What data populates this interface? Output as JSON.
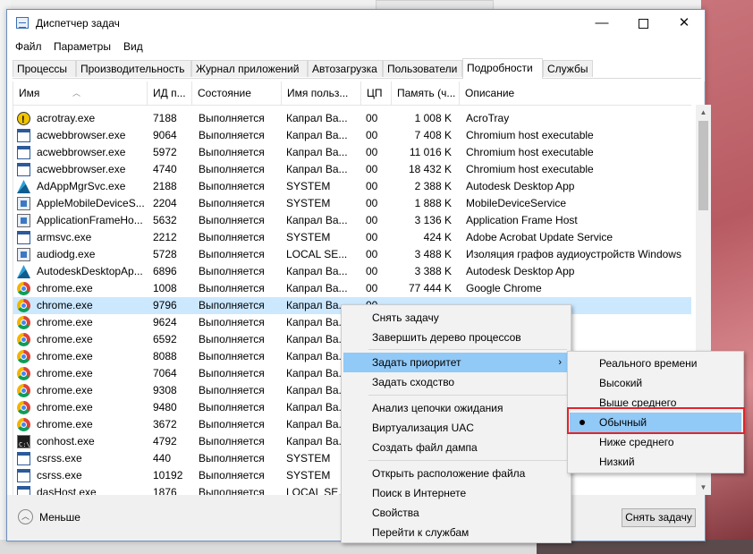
{
  "window": {
    "title": "Диспетчер задач",
    "minimize": "—",
    "close": "✕"
  },
  "menu": [
    "Файл",
    "Параметры",
    "Вид"
  ],
  "tabs": [
    "Процессы",
    "Производительность",
    "Журнал приложений",
    "Автозагрузка",
    "Пользователи",
    "Подробности",
    "Службы"
  ],
  "active_tab": "Подробности",
  "columns": [
    "Имя",
    "ИД п...",
    "Состояние",
    "Имя польз...",
    "ЦП",
    "Память (ч...",
    "Описание"
  ],
  "rows": [
    {
      "icon": "warning-icon",
      "name": "acrotray.exe",
      "pid": "7188",
      "state": "Выполняется",
      "user": "Капрал Ва...",
      "cpu": "00",
      "mem": "1 008 K",
      "desc": "AcroTray"
    },
    {
      "icon": "window-icon",
      "name": "acwebbrowser.exe",
      "pid": "9064",
      "state": "Выполняется",
      "user": "Капрал Ва...",
      "cpu": "00",
      "mem": "7 408 K",
      "desc": "Chromium host executable"
    },
    {
      "icon": "window-icon",
      "name": "acwebbrowser.exe",
      "pid": "5972",
      "state": "Выполняется",
      "user": "Капрал Ва...",
      "cpu": "00",
      "mem": "11 016 K",
      "desc": "Chromium host executable"
    },
    {
      "icon": "window-icon",
      "name": "acwebbrowser.exe",
      "pid": "4740",
      "state": "Выполняется",
      "user": "Капрал Ва...",
      "cpu": "00",
      "mem": "18 432 K",
      "desc": "Chromium host executable"
    },
    {
      "icon": "autodesk-icon",
      "name": "AdAppMgrSvc.exe",
      "pid": "2188",
      "state": "Выполняется",
      "user": "SYSTEM",
      "cpu": "00",
      "mem": "2 388 K",
      "desc": "Autodesk Desktop App"
    },
    {
      "icon": "service-icon",
      "name": "AppleMobileDeviceS...",
      "pid": "2204",
      "state": "Выполняется",
      "user": "SYSTEM",
      "cpu": "00",
      "mem": "1 888 K",
      "desc": "MobileDeviceService"
    },
    {
      "icon": "service-icon",
      "name": "ApplicationFrameHo...",
      "pid": "5632",
      "state": "Выполняется",
      "user": "Капрал Ва...",
      "cpu": "00",
      "mem": "3 136 K",
      "desc": "Application Frame Host"
    },
    {
      "icon": "window-icon",
      "name": "armsvc.exe",
      "pid": "2212",
      "state": "Выполняется",
      "user": "SYSTEM",
      "cpu": "00",
      "mem": "424 K",
      "desc": "Adobe Acrobat Update Service"
    },
    {
      "icon": "service-icon",
      "name": "audiodg.exe",
      "pid": "5728",
      "state": "Выполняется",
      "user": "LOCAL SE...",
      "cpu": "00",
      "mem": "3 488 K",
      "desc": "Изоляция графов аудиоустройств Windows"
    },
    {
      "icon": "autodesk-icon",
      "name": "AutodeskDesktopAp...",
      "pid": "6896",
      "state": "Выполняется",
      "user": "Капрал Ва...",
      "cpu": "00",
      "mem": "3 388 K",
      "desc": "Autodesk Desktop App"
    },
    {
      "icon": "chrome-icon",
      "name": "chrome.exe",
      "pid": "1008",
      "state": "Выполняется",
      "user": "Капрал Ва...",
      "cpu": "00",
      "mem": "77 444 K",
      "desc": "Google Chrome"
    },
    {
      "icon": "chrome-icon",
      "name": "chrome.exe",
      "pid": "9796",
      "state": "Выполняется",
      "user": "Капрал Ва...",
      "cpu": "00",
      "mem": "",
      "desc": ""
    },
    {
      "icon": "chrome-icon",
      "name": "chrome.exe",
      "pid": "9624",
      "state": "Выполняется",
      "user": "Капрал Ва...",
      "cpu": "",
      "mem": "",
      "desc": ""
    },
    {
      "icon": "chrome-icon",
      "name": "chrome.exe",
      "pid": "6592",
      "state": "Выполняется",
      "user": "Капрал Ва...",
      "cpu": "",
      "mem": "",
      "desc": ""
    },
    {
      "icon": "chrome-icon",
      "name": "chrome.exe",
      "pid": "8088",
      "state": "Выполняется",
      "user": "Капрал Ва...",
      "cpu": "",
      "mem": "",
      "desc": ""
    },
    {
      "icon": "chrome-icon",
      "name": "chrome.exe",
      "pid": "7064",
      "state": "Выполняется",
      "user": "Капрал Ва...",
      "cpu": "",
      "mem": "",
      "desc": ""
    },
    {
      "icon": "chrome-icon",
      "name": "chrome.exe",
      "pid": "9308",
      "state": "Выполняется",
      "user": "Капрал Ва...",
      "cpu": "",
      "mem": "",
      "desc": ""
    },
    {
      "icon": "chrome-icon",
      "name": "chrome.exe",
      "pid": "9480",
      "state": "Выполняется",
      "user": "Капрал Ва...",
      "cpu": "",
      "mem": "",
      "desc": ""
    },
    {
      "icon": "chrome-icon",
      "name": "chrome.exe",
      "pid": "3672",
      "state": "Выполняется",
      "user": "Капрал Ва...",
      "cpu": "",
      "mem": "",
      "desc": ""
    },
    {
      "icon": "console-icon",
      "name": "conhost.exe",
      "pid": "4792",
      "state": "Выполняется",
      "user": "Капрал Ва...",
      "cpu": "",
      "mem": "",
      "desc": ""
    },
    {
      "icon": "window-icon",
      "name": "csrss.exe",
      "pid": "440",
      "state": "Выполняется",
      "user": "SYSTEM",
      "cpu": "",
      "mem": "",
      "desc": ""
    },
    {
      "icon": "window-icon",
      "name": "csrss.exe",
      "pid": "10192",
      "state": "Выполняется",
      "user": "SYSTEM",
      "cpu": "",
      "mem": "",
      "desc": "иент-сервер"
    },
    {
      "icon": "window-icon",
      "name": "dasHost.exe",
      "pid": "1876",
      "state": "Выполняется",
      "user": "LOCAL SE...",
      "cpu": "",
      "mem": "",
      "desc": "twork Provider Host"
    }
  ],
  "selected_row": 11,
  "context_menu": {
    "items": [
      "Снять задачу",
      "Завершить дерево процессов",
      "Задать приоритет",
      "Задать сходство",
      "Анализ цепочки ожидания",
      "Виртуализация UAC",
      "Создать файл дампа",
      "Открыть расположение файла",
      "Поиск в Интернете",
      "Свойства",
      "Перейти к службам"
    ],
    "submenu_arrow": "›"
  },
  "priority_submenu": {
    "items": [
      "Реального времени",
      "Высокий",
      "Выше среднего",
      "Обычный",
      "Ниже среднего",
      "Низкий"
    ],
    "selected": "Обычный"
  },
  "footer": {
    "less_label": "Меньше",
    "end_task_label": "Снять задачу"
  },
  "colors": {
    "selection": "#cce8ff",
    "menu_highlight": "#91c9f7",
    "annotation_box": "#e0252b"
  }
}
